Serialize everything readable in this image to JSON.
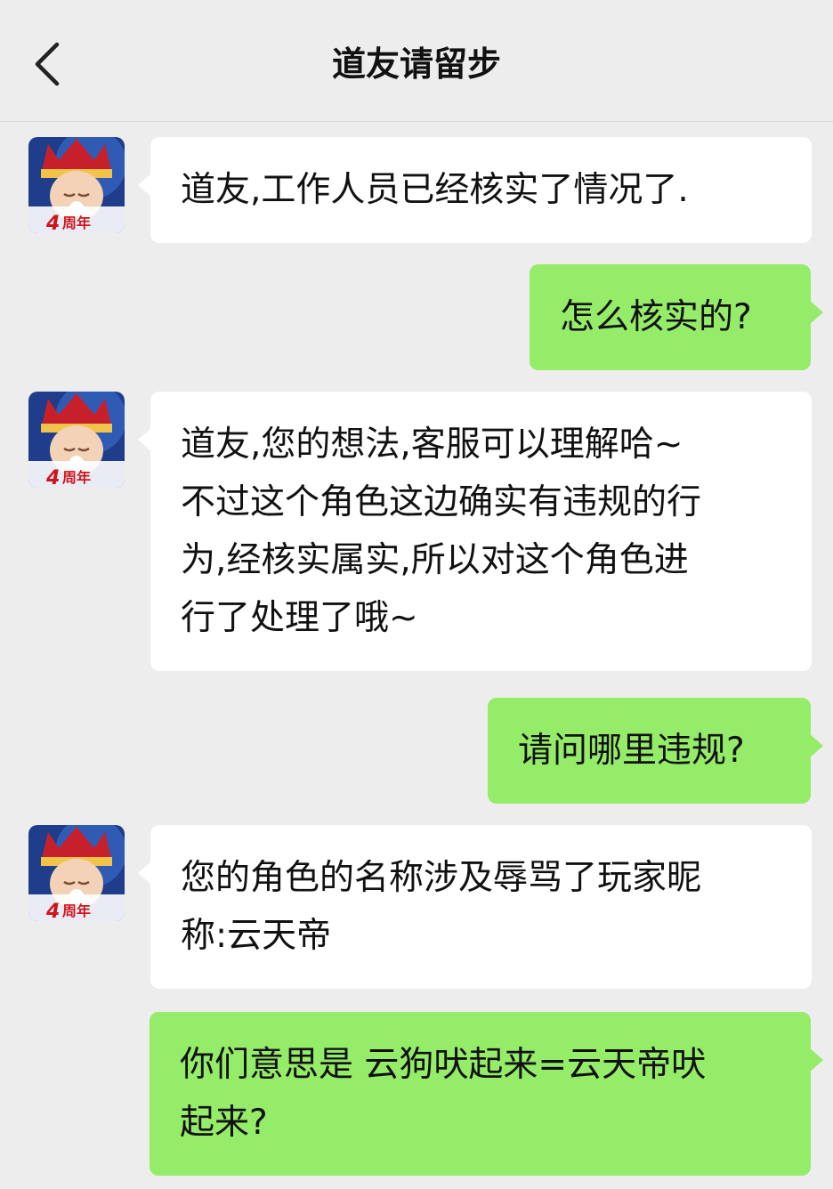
{
  "header": {
    "title": "道友请留步",
    "back_icon": "chevron-left-icon"
  },
  "avatar": {
    "badge_text": "4周年",
    "colors": {
      "crown": "#c8202b",
      "face": "#f3d2b8",
      "sky": "#1f3d8a"
    }
  },
  "messages": [
    {
      "from": "service",
      "text": "道友,工作人员已经核实了情况了."
    },
    {
      "from": "user",
      "text": "怎么核实的?"
    },
    {
      "from": "service",
      "text": "道友,您的想法,客服可以理解哈~\n不过这个角色这边确实有违规的行\n为,经核实属实,所以对这个角色进\n行了处理了哦~"
    },
    {
      "from": "user",
      "text": "请问哪里违规?"
    },
    {
      "from": "service",
      "text": "您的角色的名称涉及辱骂了玩家昵\n称:云天帝"
    },
    {
      "from": "user",
      "text": "你们意思是 云狗吠起来=云天帝吠\n起来?"
    }
  ],
  "colors": {
    "background": "#ededed",
    "incoming_bubble": "#ffffff",
    "outgoing_bubble": "#95ec69"
  }
}
